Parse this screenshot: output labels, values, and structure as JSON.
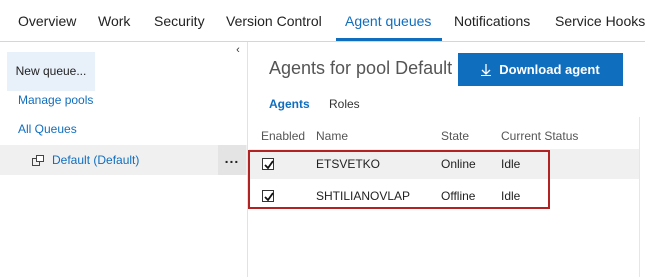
{
  "nav": {
    "tabs": [
      {
        "label": "Overview"
      },
      {
        "label": "Work"
      },
      {
        "label": "Security"
      },
      {
        "label": "Version Control"
      },
      {
        "label": "Agent queues"
      },
      {
        "label": "Notifications"
      },
      {
        "label": "Service Hooks"
      }
    ],
    "active_tab": "Agent queues"
  },
  "sidebar": {
    "new_queue_label": "New queue...",
    "manage_pools_label": "Manage pools",
    "all_queues_label": "All Queues",
    "queues": [
      {
        "label": "Default (Default)",
        "more_label": "..."
      }
    ]
  },
  "main": {
    "title": "Agents for pool Default",
    "download_label": "Download agent",
    "subtabs": [
      {
        "label": "Agents"
      },
      {
        "label": "Roles"
      }
    ],
    "columns": [
      "Enabled",
      "Name",
      "State",
      "Current Status"
    ],
    "agents": [
      {
        "enabled": true,
        "name": "ETSVETKO",
        "state": "Online",
        "status": "Idle"
      },
      {
        "enabled": true,
        "name": "SHTILIANOVLAP",
        "state": "Offline",
        "status": "Idle"
      }
    ]
  },
  "colors": {
    "accent": "#106ebe",
    "online_indicator": "#2e8b3a",
    "highlight_box": "#b22222"
  }
}
